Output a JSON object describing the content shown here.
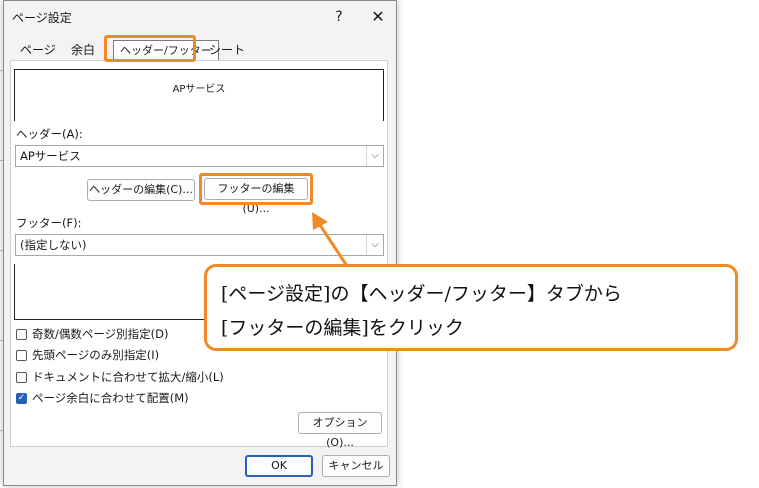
{
  "dialog": {
    "title": "ページ設定",
    "help_icon": "help-icon",
    "close_icon": "close-icon",
    "tabs": [
      {
        "label": "ページ"
      },
      {
        "label": "余白"
      },
      {
        "label": "ヘッダー/フッター"
      },
      {
        "label": "シート"
      }
    ],
    "header_preview": "APサービス",
    "header_label": "ヘッダー(A):",
    "header_value": "APサービス",
    "edit_header_button": "ヘッダーの編集(C)...",
    "edit_footer_button": "フッターの編集(U)...",
    "footer_label": "フッター(F):",
    "footer_value": "(指定しない)",
    "checkboxes": [
      {
        "label": "奇数/偶数ページ別指定(D)",
        "checked": false
      },
      {
        "label": "先頭ページのみ別指定(I)",
        "checked": false
      },
      {
        "label": "ドキュメントに合わせて拡大/縮小(L)",
        "checked": false
      },
      {
        "label": "ページ余白に合わせて配置(M)",
        "checked": true
      }
    ],
    "options_button": "オプション(O)...",
    "ok_button": "OK",
    "cancel_button": "キャンセル"
  },
  "callout": {
    "line1": "[ページ設定]の【ヘッダー/フッター】タブから",
    "line2": "[フッターの編集]をクリック"
  },
  "colors": {
    "highlight": "#f08a24",
    "accent": "#2a5fb7"
  }
}
